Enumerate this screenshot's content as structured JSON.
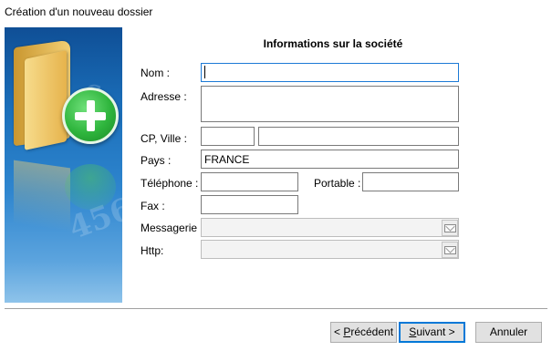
{
  "window": {
    "title": "Création d'un nouveau dossier"
  },
  "form": {
    "title": "Informations sur la société",
    "labels": {
      "nom": "Nom :",
      "adresse": "Adresse :",
      "cp_ville": "CP, Ville :",
      "pays": "Pays :",
      "telephone": "Téléphone :",
      "portable": "Portable :",
      "fax": "Fax :",
      "messagerie": "Messagerie :",
      "http": "Http:"
    },
    "values": {
      "nom": "",
      "adresse": "",
      "cp": "",
      "ville": "",
      "pays": "FRANCE",
      "telephone": "",
      "portable": "",
      "fax": "",
      "messagerie": "",
      "http": ""
    }
  },
  "buttons": {
    "precedent": {
      "prefix": "< ",
      "mnemonic": "P",
      "rest": "récédent"
    },
    "suivant": {
      "mnemonic": "S",
      "rest": "uivant",
      "suffix": " >"
    },
    "annuler": "Annuler"
  },
  "colors": {
    "accent": "#0078d7",
    "focus_border": "#1c7ad6",
    "side_panel": "#1b6fba"
  },
  "icons": [
    "folder-icon",
    "plus-icon",
    "mail-icon",
    "link-icon"
  ]
}
